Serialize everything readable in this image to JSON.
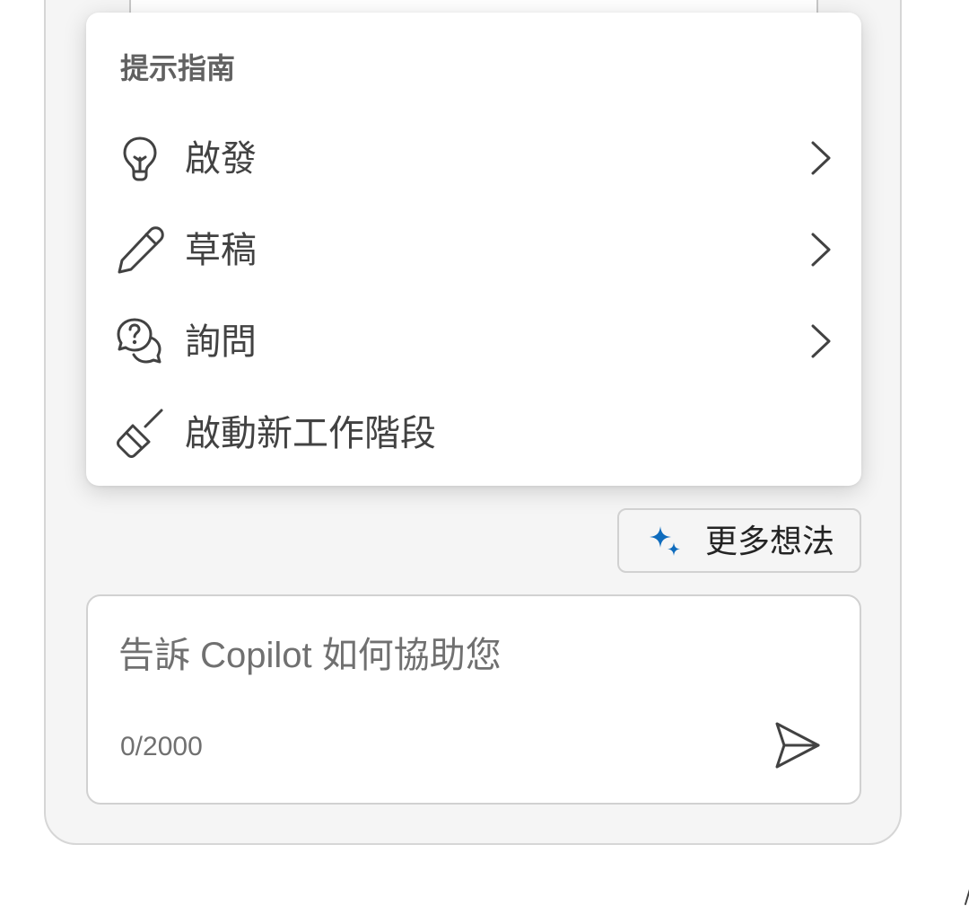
{
  "menu": {
    "header": "提示指南",
    "items": [
      {
        "label": "啟發",
        "icon": "lightbulb-icon",
        "has_submenu": true
      },
      {
        "label": "草稿",
        "icon": "pencil-icon",
        "has_submenu": true
      },
      {
        "label": "詢問",
        "icon": "chat-question-icon",
        "has_submenu": true
      },
      {
        "label": "啟動新工作階段",
        "icon": "broom-icon",
        "has_submenu": false
      }
    ]
  },
  "more_ideas": {
    "label": "更多想法",
    "icon": "sparkle-icon",
    "icon_color": "#0f6cbd"
  },
  "composer": {
    "placeholder": "告訴 Copilot 如何協助您",
    "value": "",
    "counter": "0/2000",
    "send_icon": "send-icon"
  },
  "colors": {
    "panel_bg": "#f5f5f5",
    "border": "#d1d1d1",
    "text": "#424242",
    "accent": "#0f6cbd"
  }
}
